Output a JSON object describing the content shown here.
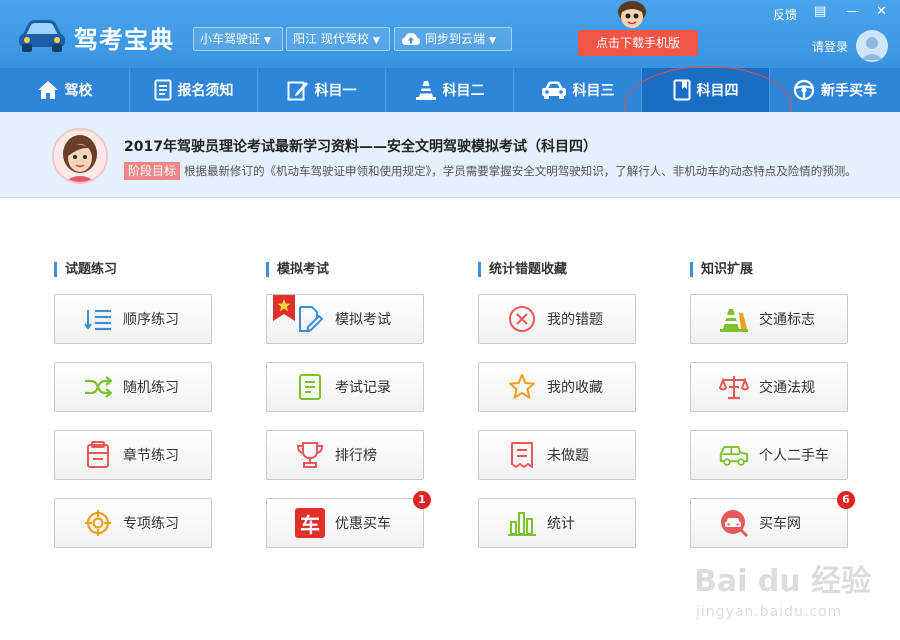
{
  "app": {
    "title": "驾考宝典",
    "license_dropdown": "小车驾驶证",
    "school_dropdown": "阳江 现代驾校",
    "sync_dropdown": "同步到云端",
    "download_button": "点击下载手机版",
    "feedback": "反馈",
    "login": "请登录"
  },
  "nav": {
    "items": [
      {
        "label": "驾校",
        "icon": "home-icon"
      },
      {
        "label": "报名须知",
        "icon": "document-icon"
      },
      {
        "label": "科目一",
        "icon": "edit-icon"
      },
      {
        "label": "科目二",
        "icon": "cone-icon"
      },
      {
        "label": "科目三",
        "icon": "car-icon"
      },
      {
        "label": "科目四",
        "icon": "book-icon",
        "active": true
      },
      {
        "label": "新手买车",
        "icon": "steering-wheel-icon"
      }
    ]
  },
  "banner": {
    "title": "2017年驾驶员理论考试最新学习资料——安全文明驾驶模拟考试（科目四）",
    "stage_label": "阶段目标",
    "description": "根据最新修订的《机动车驾驶证申领和使用规定》，学员需要掌握安全文明驾驶知识，了解行人、非机动车的动态特点及险情的预测。"
  },
  "sections": [
    {
      "title": "试题练习",
      "cards": [
        {
          "label": "顺序练习",
          "icon": "ordered-list-icon"
        },
        {
          "label": "随机练习",
          "icon": "shuffle-icon"
        },
        {
          "label": "章节练习",
          "icon": "chapter-icon"
        },
        {
          "label": "专项练习",
          "icon": "target-icon"
        }
      ]
    },
    {
      "title": "模拟考试",
      "cards": [
        {
          "label": "模拟考试",
          "icon": "exam-edit-icon"
        },
        {
          "label": "考试记录",
          "icon": "record-icon"
        },
        {
          "label": "排行榜",
          "icon": "trophy-icon"
        },
        {
          "label": "优惠买车",
          "icon": "buy-car-icon",
          "badge": "1",
          "icon_text": "车"
        }
      ]
    },
    {
      "title": "统计错题收藏",
      "cards": [
        {
          "label": "我的错题",
          "icon": "wrong-icon"
        },
        {
          "label": "我的收藏",
          "icon": "star-icon"
        },
        {
          "label": "未做题",
          "icon": "receipt-icon"
        },
        {
          "label": "统计",
          "icon": "bar-chart-icon"
        }
      ]
    },
    {
      "title": "知识扩展",
      "cards": [
        {
          "label": "交通标志",
          "icon": "traffic-sign-icon"
        },
        {
          "label": "交通法规",
          "icon": "scales-icon"
        },
        {
          "label": "个人二手车",
          "icon": "jeep-icon"
        },
        {
          "label": "买车网",
          "icon": "car-search-icon",
          "badge": "6"
        }
      ]
    }
  ],
  "watermark": {
    "text": "Bai du 经验",
    "url": "jingyan.baidu.com"
  },
  "colors": {
    "title_bar": "#3a93e0",
    "nav_bar": "#2f86d8",
    "nav_active": "#1a6fc4",
    "download": "#f05545",
    "badge": "#e02424",
    "accent_blue": "#3a8fdc"
  }
}
